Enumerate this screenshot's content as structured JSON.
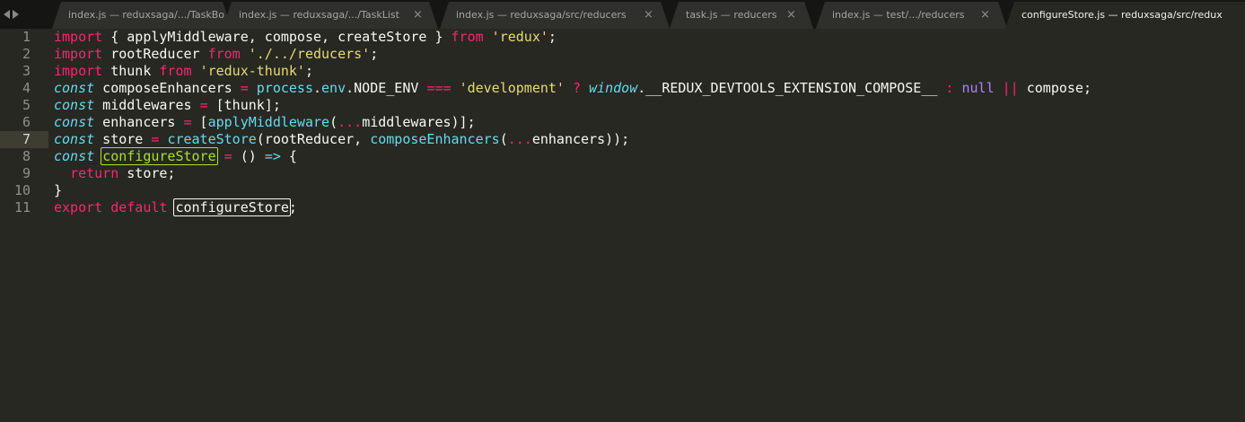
{
  "tabs": [
    {
      "label": "index.js — reduxsaga/.../TaskBo",
      "close": "×",
      "active": false
    },
    {
      "label": "index.js — reduxsaga/.../TaskList",
      "close": "×",
      "active": false
    },
    {
      "label": "index.js — reduxsaga/src/reducers",
      "close": "×",
      "active": false
    },
    {
      "label": "task.js — reducers",
      "close": "×",
      "active": false
    },
    {
      "label": "index.js — test/.../reducers",
      "close": "×",
      "active": false
    },
    {
      "label": "configureStore.js — reduxsaga/src/redux",
      "close": "",
      "active": true
    }
  ],
  "editor": {
    "current_line": 7,
    "line_numbers": [
      "1",
      "2",
      "3",
      "4",
      "5",
      "6",
      "7",
      "8",
      "9",
      "10",
      "11"
    ],
    "tokens": {
      "l1": [
        "import",
        " { applyMiddleware, compose, createStore } ",
        "from",
        " ",
        "'redux'",
        ";"
      ],
      "l2": [
        "import",
        " rootReducer ",
        "from",
        " ",
        "'./../reducers'",
        ";"
      ],
      "l3": [
        "import",
        " thunk ",
        "from",
        " ",
        "'redux-thunk'",
        ";"
      ],
      "l4": [
        "const",
        " composeEnhancers ",
        "=",
        " ",
        "process",
        ".",
        "env",
        ".NODE_ENV ",
        "===",
        " ",
        "'development'",
        " ",
        "?",
        " ",
        "window",
        ".__REDUX_DEVTOOLS_EXTENSION_COMPOSE__ ",
        ":",
        " ",
        "null",
        " ",
        "||",
        " compose;"
      ],
      "l5": [
        "const",
        " middlewares ",
        "=",
        " [thunk];"
      ],
      "l6": [
        "const",
        " enhancers ",
        "=",
        " [",
        "applyMiddleware",
        "(",
        "...",
        "middlewares)];"
      ],
      "l7": [
        "const",
        " store ",
        "=",
        " ",
        "createStore",
        "(rootReducer, ",
        "composeEnhancers",
        "(",
        "...",
        "enhancers));"
      ],
      "l8": [
        "const",
        " ",
        "configureStore",
        " ",
        "=",
        " () ",
        "=>",
        " {"
      ],
      "l9": [
        "  ",
        "return",
        " store;"
      ],
      "l10": [
        "}"
      ],
      "l11": [
        "export",
        " ",
        "default",
        " ",
        "configureStore",
        ";"
      ]
    }
  },
  "colors": {
    "background": "#272822",
    "tabbar": "#151613",
    "keyword": "#f92672",
    "string": "#e6db74",
    "storage": "#66d9ef",
    "function": "#66d9ef",
    "constant": "#ae81ff",
    "highlight_green": "#a6e22e",
    "text": "#f8f8f2"
  }
}
